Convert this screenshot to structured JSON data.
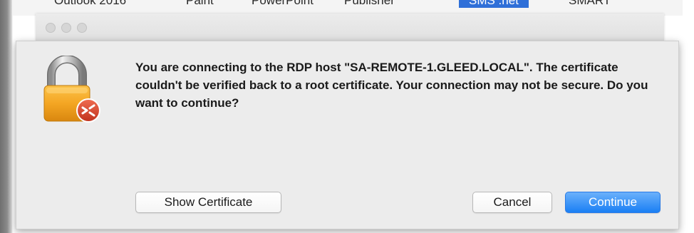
{
  "background_app": {
    "menu_items": [
      "Outlook 2016",
      "Paint",
      "PowerPoint",
      "Publisher",
      "SMS .net",
      "SMART"
    ],
    "selected_item": "SMS .net"
  },
  "dialog": {
    "message": "You are connecting to the RDP host \"SA-REMOTE-1.GLEED.LOCAL\". The certificate couldn't be verified back to a root certificate. Your connection may not be secure. Do you want to continue?",
    "icon": "padlock-remote-desktop-icon",
    "buttons": {
      "show_certificate": "Show Certificate",
      "cancel": "Cancel",
      "continue": "Continue"
    }
  },
  "colors": {
    "accent": "#1a7ff4",
    "lock_body": "#f4a623",
    "badge": "#d9452e",
    "dialog_bg": "#ececec"
  }
}
